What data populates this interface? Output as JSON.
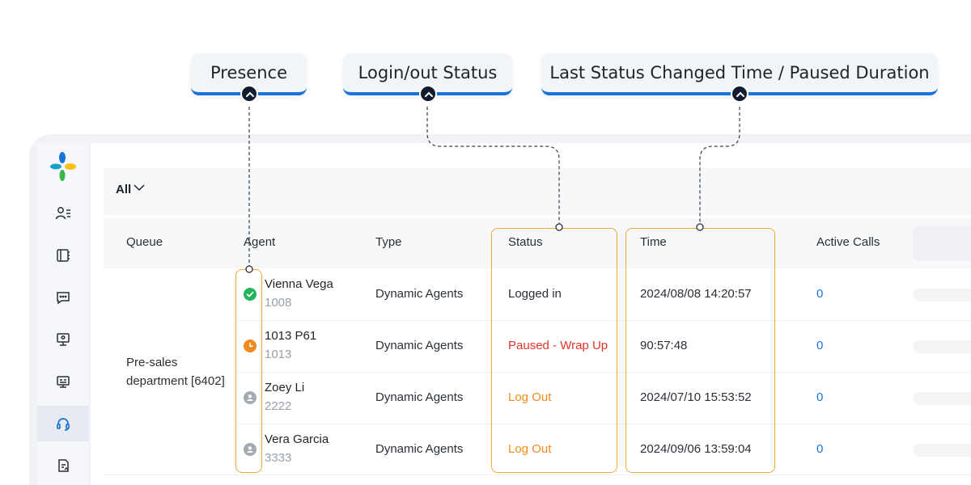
{
  "callouts": {
    "presence": "Presence",
    "login_status": "Login/out Status",
    "last_status": "Last Status Changed Time / Paused Duration"
  },
  "filter": {
    "label": "All"
  },
  "table": {
    "headers": {
      "queue": "Queue",
      "agent": "Agent",
      "type": "Type",
      "status": "Status",
      "time": "Time",
      "active_calls": "Active Calls"
    },
    "queue_line1": "Pre-sales",
    "queue_line2": "department [6402]",
    "rows": [
      {
        "name": "Vienna Vega",
        "ext": "1008",
        "type": "Dynamic Agents",
        "status": "Logged in",
        "time": "2024/08/08 14:20:57",
        "calls": "0",
        "presence": "available"
      },
      {
        "name": "1013 P61",
        "ext": "1013",
        "type": "Dynamic Agents",
        "status": "Paused - Wrap Up",
        "time": "90:57:48",
        "calls": "0",
        "presence": "paused"
      },
      {
        "name": "Zoey Li",
        "ext": "2222",
        "type": "Dynamic Agents",
        "status": "Log Out",
        "time": "2024/07/10 15:53:52",
        "calls": "0",
        "presence": "offline"
      },
      {
        "name": "Vera Garcia",
        "ext": "3333",
        "type": "Dynamic Agents",
        "status": "Log Out",
        "time": "2024/09/06 13:59:04",
        "calls": "0",
        "presence": "offline"
      }
    ]
  },
  "colors": {
    "accent": "#1a73d9",
    "status_logged_in": "#2b2f36",
    "status_paused": "#e0352b",
    "status_logout": "#f08a1c",
    "presence_available": "#23b45a",
    "presence_paused": "#f08a1c",
    "presence_offline": "#a4aab3",
    "highlight": "#f2a93b"
  },
  "sidebar_icons": [
    "logo-icon",
    "contacts-icon",
    "phonebook-icon",
    "chat-icon",
    "monitor-icon",
    "dashboard-icon",
    "headset-icon",
    "report-icon"
  ]
}
